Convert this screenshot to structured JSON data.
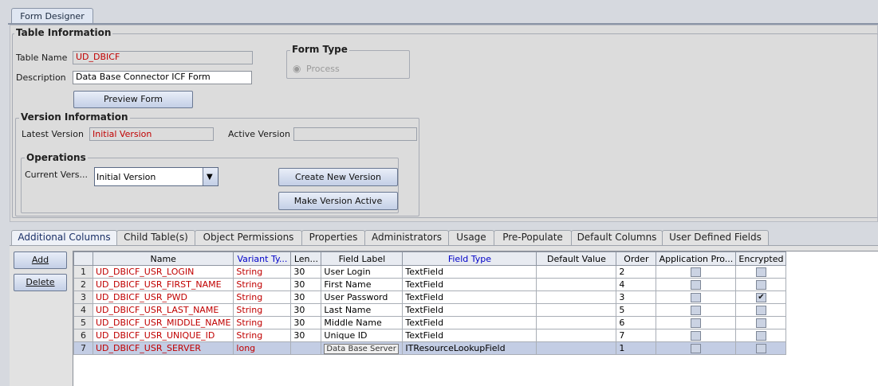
{
  "window_tab": "Form Designer",
  "table_info": {
    "legend": "Table Information",
    "table_name_label": "Table Name",
    "table_name_value": "UD_DBICF",
    "description_label": "Description",
    "description_value": "Data Base Connector ICF Form",
    "preview_button": "Preview Form"
  },
  "form_type": {
    "legend": "Form Type",
    "option": "Process"
  },
  "version_info": {
    "legend": "Version Information",
    "latest_label": "Latest Version",
    "latest_value": "Initial Version",
    "active_label": "Active Version",
    "active_value": ""
  },
  "operations": {
    "legend": "Operations",
    "current_label": "Current Vers...",
    "current_value": "Initial Version",
    "create_button": "Create New Version",
    "make_active_button": "Make Version Active"
  },
  "tabs": [
    "Additional Columns",
    "Child Table(s)",
    "Object Permissions",
    "Properties",
    "Administrators",
    "Usage",
    "Pre-Populate",
    "Default Columns",
    "User Defined Fields"
  ],
  "side_buttons": {
    "add": "Add",
    "delete": "Delete"
  },
  "table": {
    "headers": [
      "",
      "Name",
      "Variant Ty...",
      "Len...",
      "Field Label",
      "Field Type",
      "Default Value",
      "Order",
      "Application Pro...",
      "Encrypted"
    ],
    "rows": [
      {
        "num": "1",
        "name": "UD_DBICF_USR_LOGIN",
        "variant": "String",
        "len": "30",
        "label": "User Login",
        "ftype": "TextField",
        "default": "",
        "order": "2",
        "app": false,
        "enc": false
      },
      {
        "num": "2",
        "name": "UD_DBICF_USR_FIRST_NAME",
        "variant": "String",
        "len": "30",
        "label": "First Name",
        "ftype": "TextField",
        "default": "",
        "order": "4",
        "app": false,
        "enc": false
      },
      {
        "num": "3",
        "name": "UD_DBICF_USR_PWD",
        "variant": "String",
        "len": "30",
        "label": "User Password",
        "ftype": "TextField",
        "default": "",
        "order": "3",
        "app": false,
        "enc": true
      },
      {
        "num": "4",
        "name": "UD_DBICF_USR_LAST_NAME",
        "variant": "String",
        "len": "30",
        "label": "Last Name",
        "ftype": "TextField",
        "default": "",
        "order": "5",
        "app": false,
        "enc": false
      },
      {
        "num": "5",
        "name": "UD_DBICF_USR_MIDDLE_NAME",
        "variant": "String",
        "len": "30",
        "label": "Middle Name",
        "ftype": "TextField",
        "default": "",
        "order": "6",
        "app": false,
        "enc": false
      },
      {
        "num": "6",
        "name": "UD_DBICF_USR_UNIQUE_ID",
        "variant": "String",
        "len": "30",
        "label": "Unique ID",
        "ftype": "TextField",
        "default": "",
        "order": "7",
        "app": false,
        "enc": false
      },
      {
        "num": "7",
        "name": "UD_DBICF_USR_SERVER",
        "variant": "long",
        "len": "",
        "label": "Data Base Server",
        "ftype": "ITResourceLookupField",
        "default": "",
        "order": "1",
        "app": false,
        "enc": false
      }
    ]
  },
  "check_mark": "✔"
}
